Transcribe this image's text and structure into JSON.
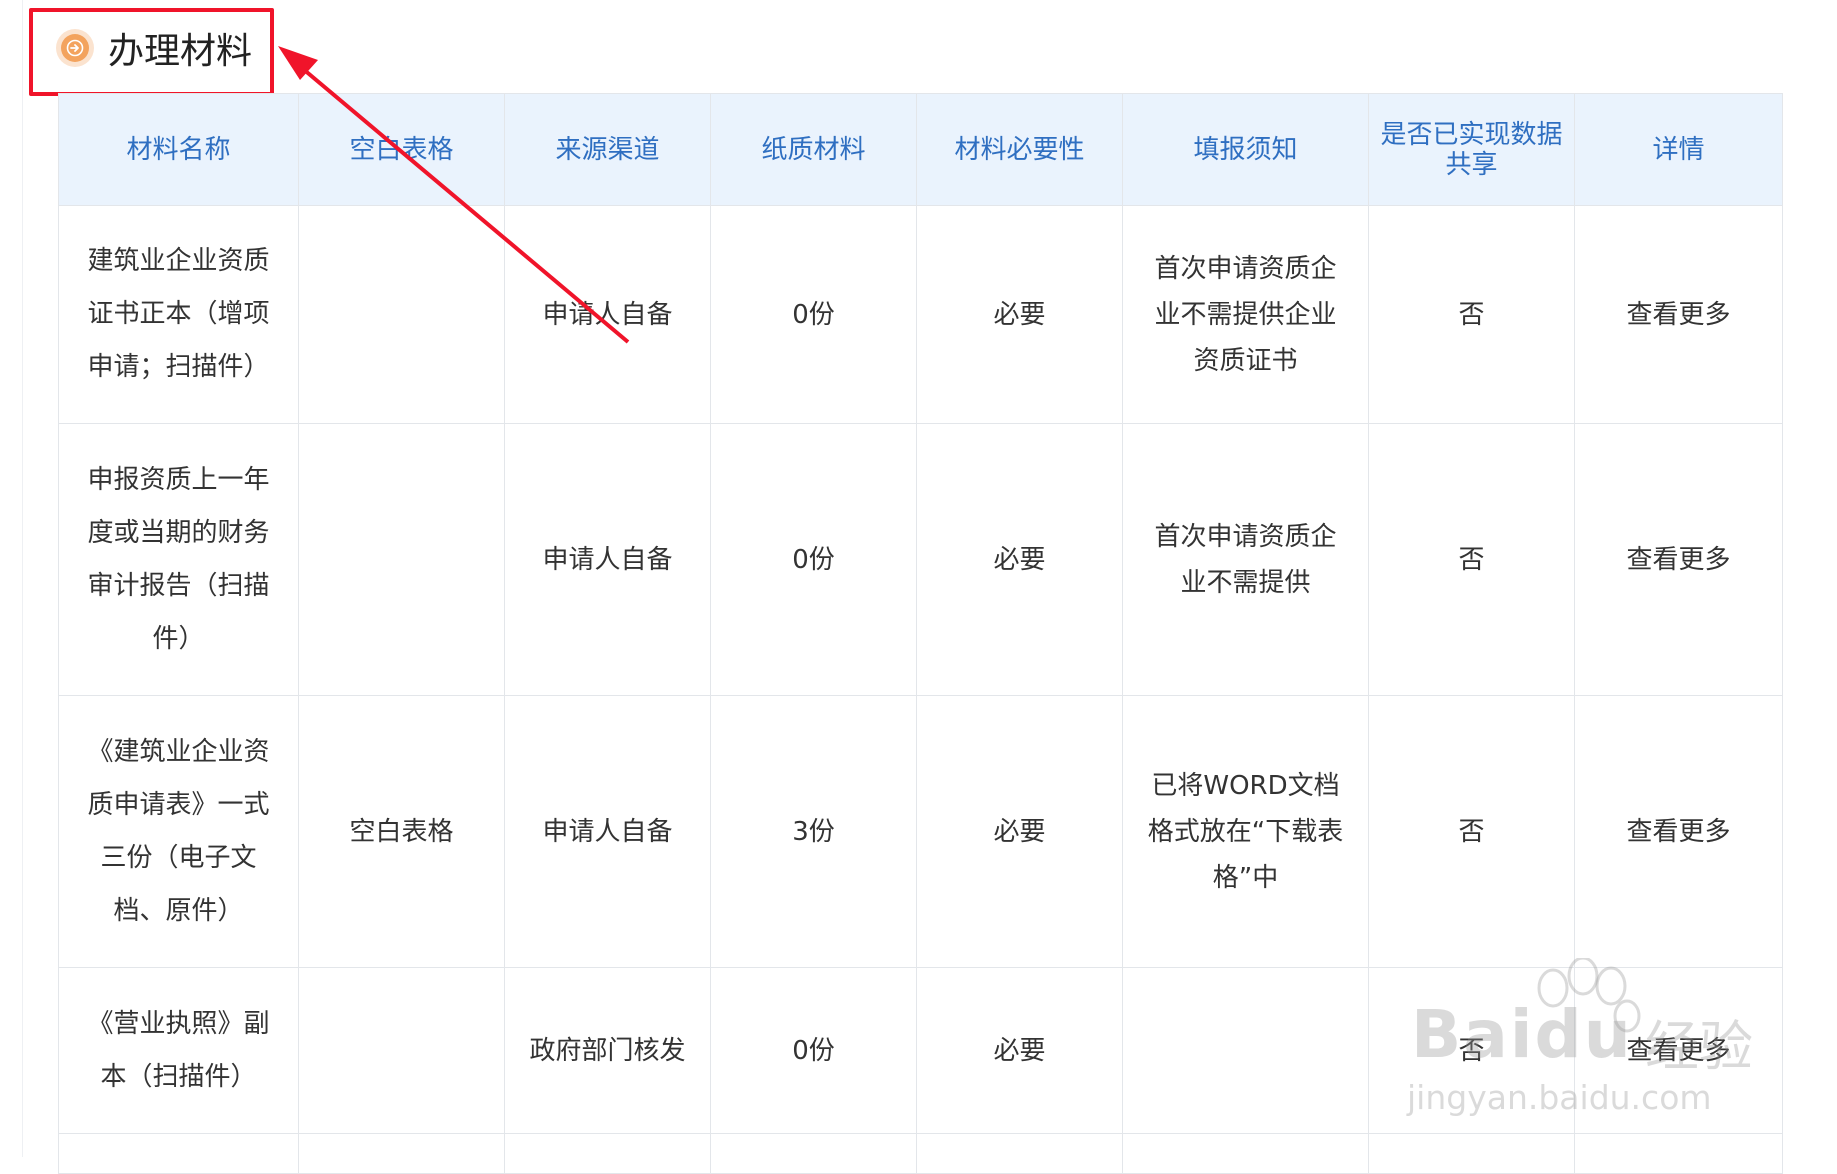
{
  "section": {
    "title": "办理材料",
    "icon": "arrow-right-circle-icon",
    "accent_color": "#f3a35e",
    "highlight_color": "#f0142a"
  },
  "table": {
    "headers": [
      "材料名称",
      "空白表格",
      "来源渠道",
      "纸质材料",
      "材料必要性",
      "填报须知",
      "是否已实现数据共享",
      "详情"
    ],
    "rows": [
      {
        "name": "建筑业企业资质证书正本（增项申请；扫描件）",
        "blank_form": "",
        "source": "申请人自备",
        "paper": "0份",
        "necessity": "必要",
        "notice": "首次申请资质企业不需提供企业资质证书",
        "shared": "否",
        "detail": "查看更多"
      },
      {
        "name": "申报资质上一年度或当期的财务审计报告（扫描件）",
        "blank_form": "",
        "source": "申请人自备",
        "paper": "0份",
        "necessity": "必要",
        "notice": "首次申请资质企业不需提供",
        "shared": "否",
        "detail": "查看更多"
      },
      {
        "name": "《建筑业企业资质申请表》一式三份（电子文档、原件）",
        "blank_form": "空白表格",
        "source": "申请人自备",
        "paper": "3份",
        "necessity": "必要",
        "notice": "已将WORD文档格式放在“下载表格”中",
        "shared": "否",
        "detail": "查看更多"
      },
      {
        "name": "《营业执照》副本（扫描件）",
        "blank_form": "",
        "source": "政府部门核发",
        "paper": "0份",
        "necessity": "必要",
        "notice": "",
        "shared": "否",
        "detail": "查看更多"
      }
    ]
  },
  "watermark": {
    "brand": "Baidu",
    "cn": "经验",
    "url": "jingyan.baidu.com"
  }
}
